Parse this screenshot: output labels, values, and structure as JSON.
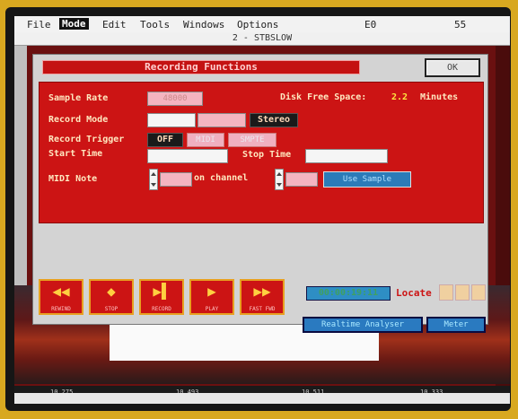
{
  "menu": {
    "items": [
      "File",
      "Mode",
      "Edit",
      "Tools",
      "Windows",
      "Options"
    ],
    "active_index": 1,
    "right_a": "E0",
    "right_b": "55"
  },
  "window_title": "2 - STBSLOW",
  "dialog": {
    "title": "Recording Functions",
    "ok_label": "OK",
    "sample_rate": {
      "label": "Sample Rate",
      "value": "48000"
    },
    "disk_free": {
      "label": "Disk Free Space:",
      "value": "2.2",
      "unit": "Minutes"
    },
    "record_mode": {
      "label": "Record Mode",
      "option_stereo": "Stereo"
    },
    "record_trigger": {
      "label": "Record Trigger",
      "off": "OFF",
      "midi": "MIDI",
      "smpte": "SMPTE"
    },
    "start_time": {
      "label": "Start Time"
    },
    "stop_time": {
      "label": "Stop Time"
    },
    "midi_note": {
      "label": "MIDI Note",
      "on_channel": "on channel",
      "sync_button": "Use Sample"
    }
  },
  "transport": {
    "buttons": [
      {
        "name": "rewind",
        "glyph": "◀◀",
        "caption": "REWIND"
      },
      {
        "name": "stop",
        "glyph": "◆",
        "caption": "STOP"
      },
      {
        "name": "record",
        "glyph": "▶▌",
        "caption": "RECORD"
      },
      {
        "name": "play",
        "glyph": "▶",
        "caption": "PLAY"
      },
      {
        "name": "fast-forward",
        "glyph": "▶▶",
        "caption": "FAST FWD"
      }
    ],
    "time_display": "00:00:19:11",
    "locate_label": "Locate"
  },
  "panels": {
    "realtime": "Realtime Analyser",
    "meter": "Meter"
  },
  "scope_ticks": [
    "10.275",
    "10.493",
    "10.511",
    "10.333"
  ]
}
